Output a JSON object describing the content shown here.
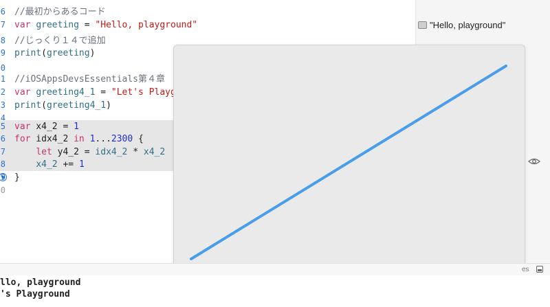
{
  "editor": {
    "lines": [
      {
        "n": "6",
        "seg": [
          {
            "t": "//最初からあるコード",
            "c": "cmt"
          }
        ]
      },
      {
        "n": "7",
        "seg": [
          {
            "t": "var",
            "c": "kw"
          },
          {
            "t": " "
          },
          {
            "t": "greeting",
            "c": "ident"
          },
          {
            "t": " = "
          },
          {
            "t": "\"Hello, playground\"",
            "c": "str"
          }
        ]
      },
      {
        "n": "8",
        "seg": [
          {
            "t": "//じっくり１４で追加",
            "c": "cmt"
          }
        ]
      },
      {
        "n": "9",
        "seg": [
          {
            "t": "print",
            "c": "ident"
          },
          {
            "t": "("
          },
          {
            "t": "greeting",
            "c": "ident"
          },
          {
            "t": ")"
          }
        ]
      },
      {
        "n": "0",
        "seg": []
      },
      {
        "n": "1",
        "seg": [
          {
            "t": "//iOSAppsDevsEssentials第４章",
            "c": "cmt"
          }
        ]
      },
      {
        "n": "2",
        "seg": [
          {
            "t": "var",
            "c": "kw"
          },
          {
            "t": " "
          },
          {
            "t": "greeting4_1",
            "c": "ident"
          },
          {
            "t": " = "
          },
          {
            "t": "\"Let's Playg",
            "c": "str"
          }
        ]
      },
      {
        "n": "3",
        "seg": [
          {
            "t": "print",
            "c": "ident"
          },
          {
            "t": "("
          },
          {
            "t": "greeting4_1",
            "c": "ident"
          },
          {
            "t": ")"
          }
        ]
      },
      {
        "n": "4",
        "seg": []
      },
      {
        "n": "5",
        "seg": [
          {
            "t": "var",
            "c": "kw"
          },
          {
            "t": " x4_2 = "
          },
          {
            "t": "1",
            "c": "num"
          }
        ]
      },
      {
        "n": "6",
        "seg": [
          {
            "t": "for",
            "c": "kw"
          },
          {
            "t": " idx4_2 "
          },
          {
            "t": "in",
            "c": "kw"
          },
          {
            "t": " "
          },
          {
            "t": "1",
            "c": "num"
          },
          {
            "t": "..."
          },
          {
            "t": "2300",
            "c": "num"
          },
          {
            "t": " {"
          }
        ]
      },
      {
        "n": "7",
        "seg": [
          {
            "t": "    "
          },
          {
            "t": "let",
            "c": "kw"
          },
          {
            "t": " y4_2 = "
          },
          {
            "t": "idx4_2",
            "c": "ident"
          },
          {
            "t": " * "
          },
          {
            "t": "x4_2",
            "c": "ident"
          }
        ]
      },
      {
        "n": "8",
        "seg": [
          {
            "t": "    "
          },
          {
            "t": "x4_2",
            "c": "ident"
          },
          {
            "t": " += "
          },
          {
            "t": "1",
            "c": "num"
          }
        ]
      },
      {
        "n": "9",
        "seg": [
          {
            "t": "}"
          }
        ]
      },
      {
        "n": "0",
        "seg": []
      }
    ]
  },
  "results": {
    "greeting_value": "\"Hello, playground\""
  },
  "status_bar": {
    "text": "es"
  },
  "console": {
    "lines": [
      "llo, playground",
      "'s Playground"
    ]
  },
  "colors": {
    "preview_line": "#4a9de8",
    "highlight": "#e6e6e6"
  }
}
